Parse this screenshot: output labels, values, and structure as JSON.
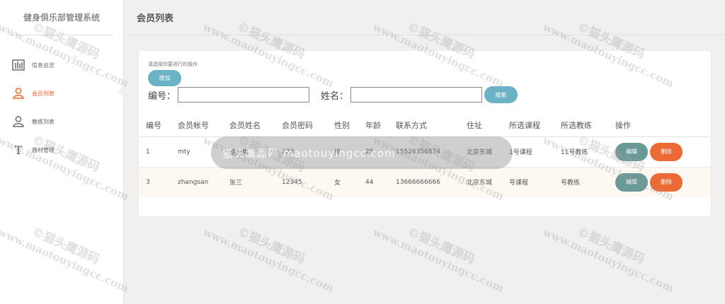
{
  "app_title": "健身俱乐部管理系统",
  "page_title": "会员列表",
  "sidebar": {
    "items": [
      {
        "label": "信息总览",
        "icon": "chart-bars-icon"
      },
      {
        "label": "会员列表",
        "icon": "user-icon",
        "active": true
      },
      {
        "label": "教练列表",
        "icon": "user-outline-icon"
      },
      {
        "label": "器材管理",
        "icon": "letter-t-icon"
      }
    ]
  },
  "toolbar": {
    "hint": "请选择你要进行的操作",
    "add_label": "增加",
    "id_label": "编号：",
    "name_label": "姓名：",
    "id_value": "",
    "name_value": "",
    "search_label": "搜索"
  },
  "table": {
    "headers": [
      "编号",
      "会员帐号",
      "会员姓名",
      "会员密码",
      "性别",
      "年龄",
      "联系方式",
      "住址",
      "所选课程",
      "所选教练",
      "操作"
    ],
    "rows": [
      {
        "id": "1",
        "account": "mty",
        "name": "猫头鹰",
        "password": "123",
        "gender": "男",
        "age": "25",
        "phone": "15526356874",
        "address": "北京东城",
        "course": "1号课程",
        "coach": "11号教练"
      },
      {
        "id": "3",
        "account": "zhangsan",
        "name": "张三",
        "password": "12345",
        "gender": "女",
        "age": "44",
        "phone": "13666666666",
        "address": "北京东城",
        "course": "号课程",
        "coach": "号教练"
      }
    ],
    "edit_label": "编辑",
    "delete_label": "删除"
  },
  "watermark": {
    "banner": "猫头鹰源码 maotouyingcc.com",
    "line1": "©猫头鹰源码",
    "line2": "www.maotouyingcc.com"
  },
  "colors": {
    "accent": "#e8672e",
    "button_blue": "#6cb2c6",
    "edit_button": "#6a9a98",
    "delete_button": "#ec6a36"
  }
}
